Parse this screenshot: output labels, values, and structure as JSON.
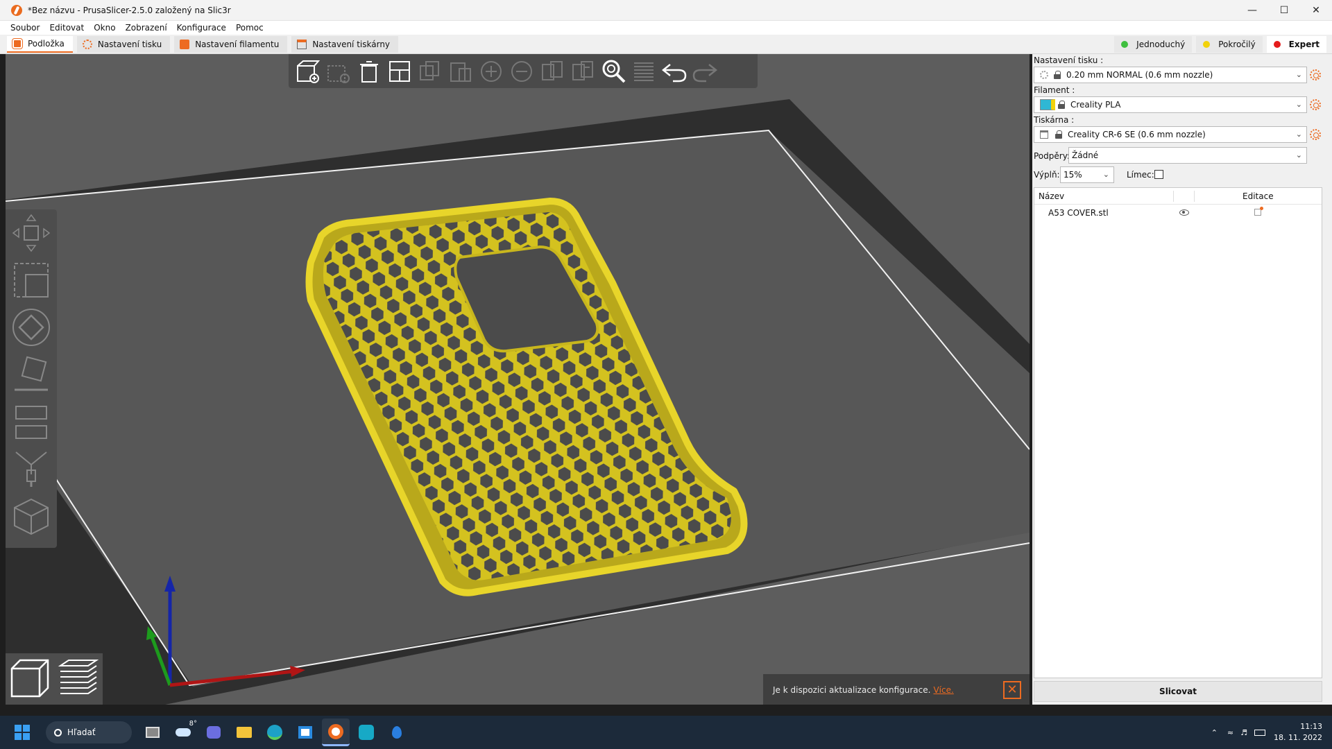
{
  "window": {
    "title": "*Bez názvu - PrusaSlicer-2.5.0 založený na Slic3r"
  },
  "menu": [
    "Soubor",
    "Editovat",
    "Okno",
    "Zobrazení",
    "Konfigurace",
    "Pomoc"
  ],
  "tabs": [
    {
      "label": "Podložka",
      "active": true
    },
    {
      "label": "Nastavení tisku",
      "active": false
    },
    {
      "label": "Nastavení filamentu",
      "active": false
    },
    {
      "label": "Nastavení tiskárny",
      "active": false
    }
  ],
  "modes": [
    {
      "label": "Jednoduchý",
      "color": "#3fbf3f"
    },
    {
      "label": "Pokročilý",
      "color": "#f2d20a"
    },
    {
      "label": "Expert",
      "color": "#e51c1c",
      "active": true
    }
  ],
  "right_panel": {
    "print_settings_label": "Nastavení tisku :",
    "print_settings_value": "0.20 mm NORMAL (0.6 mm nozzle)",
    "filament_label": "Filament :",
    "filament_value": "Creality PLA",
    "filament_color": "#2fb7d4",
    "printer_label": "Tiskárna :",
    "printer_value": "Creality CR-6 SE (0.6 mm nozzle)",
    "supports_label": "Podpěry:",
    "supports_value": "Žádné",
    "infill_label": "Výplň:",
    "infill_value": "15%",
    "brim_label": "Límec:",
    "brim_checked": false,
    "list_header_name": "Název",
    "list_header_edit": "Editace",
    "objects": [
      {
        "name": "A53 COVER.stl"
      }
    ],
    "slice_button": "Slicovat"
  },
  "notification": {
    "text": "Je k dispozici aktualizace konfigurace.",
    "link": "Více."
  },
  "taskbar": {
    "search_label": "Hľadať",
    "weather_temp": "8°",
    "time": "11:13",
    "date": "18. 11. 2022"
  },
  "colors": {
    "accent": "#ed6b21",
    "model": "#d4c21f",
    "bed": "#575757",
    "viewport_bg": "#5d5d5d"
  }
}
